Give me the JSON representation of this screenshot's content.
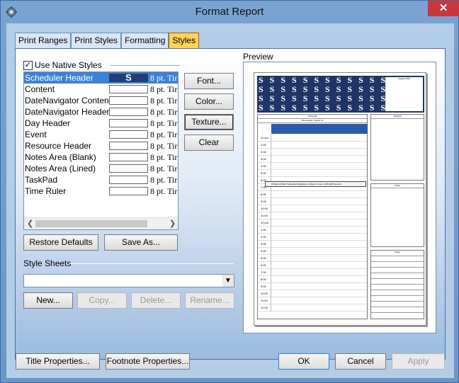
{
  "window": {
    "title": "Format Report",
    "close_glyph": "✕",
    "icon": "gear-icon"
  },
  "tabs": [
    {
      "label": "Print Ranges",
      "active": false
    },
    {
      "label": "Print Styles",
      "active": false
    },
    {
      "label": "Formatting",
      "active": false
    },
    {
      "label": "Styles",
      "active": true
    }
  ],
  "styles_panel": {
    "use_native_styles": {
      "label": "Use Native Styles",
      "checked": true,
      "check_glyph": "✓"
    },
    "list": [
      {
        "name": "Scheduler Header",
        "swatch": "S",
        "font": "8 pt. Tir",
        "selected": true
      },
      {
        "name": "Content",
        "swatch": "",
        "font": "8 pt. Tir",
        "selected": false
      },
      {
        "name": "DateNavigator Content",
        "swatch": "",
        "font": "8 pt. Tir",
        "selected": false
      },
      {
        "name": "DateNavigator Header",
        "swatch": "",
        "font": "8 pt. Tir",
        "selected": false
      },
      {
        "name": "Day Header",
        "swatch": "",
        "font": "8 pt. Tir",
        "selected": false
      },
      {
        "name": "Event",
        "swatch": "",
        "font": "8 pt. Tir",
        "selected": false
      },
      {
        "name": "Resource Header",
        "swatch": "",
        "font": "8 pt. Tir",
        "selected": false
      },
      {
        "name": "Notes Area (Blank)",
        "swatch": "",
        "font": "8 pt. Tir",
        "selected": false
      },
      {
        "name": "Notes Area (Lined)",
        "swatch": "",
        "font": "8 pt. Tir",
        "selected": false
      },
      {
        "name": "TaskPad",
        "swatch": "",
        "font": "8 pt. Tir",
        "selected": false
      },
      {
        "name": "Time Ruler",
        "swatch": "",
        "font": "8 pt. Tir",
        "selected": false
      }
    ],
    "scroll_left": "❮",
    "scroll_right": "❯",
    "buttons": {
      "font": "Font...",
      "color": "Color...",
      "texture": "Texture...",
      "clear": "Clear",
      "restore_defaults": "Restore Defaults",
      "save_as": "Save As..."
    },
    "style_sheets": {
      "label": "Style Sheets",
      "selected": "",
      "dropdown_glyph": "▼",
      "new": "New...",
      "copy": "Copy...",
      "delete": "Delete...",
      "rename": "Rename..."
    },
    "preview_label": "Preview"
  },
  "preview": {
    "header_letter": "S",
    "mini_calendar_title": "August 2014",
    "day_header": "Schpedia",
    "date_header": "Wednesday, August 13",
    "taskpad_title": "TaskPad",
    "notes_title": "Notes",
    "times": [
      "11 am",
      "1:00",
      "2:00",
      "3:00",
      "4:00",
      "5:00",
      "6:00",
      "7:00",
      "8:00",
      "9:00",
      "10:00",
      "11:00",
      "12 pm",
      "1:00",
      "2:00",
      "3:00",
      "4:00",
      "5:00",
      "6:00",
      "7:00",
      "8:00",
      "9:00",
      "10:00",
      "11:00",
      "12:00"
    ],
    "appointment": "8:00am-9:30am Softpedia Softpedia is a library of over 1,300,000 free and"
  },
  "footer": {
    "title_properties": "Title Properties...",
    "footnote_properties": "Footnote Properties...",
    "ok": "OK",
    "cancel": "Cancel",
    "apply": "Apply"
  }
}
